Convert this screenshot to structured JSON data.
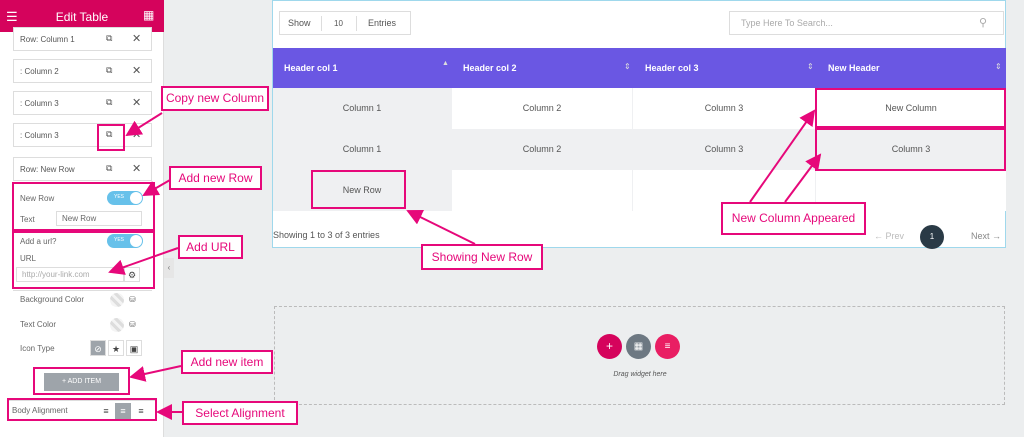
{
  "sidebar": {
    "title": "Edit Table",
    "rows": [
      {
        "label": "Row: Column 1"
      },
      {
        "label": ": Column 2"
      },
      {
        "label": ": Column 3"
      },
      {
        "label": ": Column 3"
      },
      {
        "label": "Row: New Row"
      }
    ],
    "new_row_label": "New Row",
    "text_label": "Text",
    "text_value": "New Row",
    "add_url_label": "Add a url?",
    "url_label": "URL",
    "url_placeholder": "http://your-link.com",
    "toggle_text": "YES",
    "bg_color_label": "Background Color",
    "text_color_label": "Text Color",
    "icon_type_label": "Icon Type",
    "add_item_label": "+ ADD ITEM",
    "body_alignment_label": "Body Alignment"
  },
  "table": {
    "show_label": "Show",
    "entries_count": "10",
    "entries_label": "Entries",
    "search_placeholder": "Type Here To Search...",
    "headers": [
      "Header col 1",
      "Header col 2",
      "Header col 3",
      "New Header"
    ],
    "rows": [
      [
        "Column 1",
        "Column 2",
        "Column 3",
        "New Column"
      ],
      [
        "Column 1",
        "Column 2",
        "Column 3",
        "Column 3"
      ],
      [
        "New Row",
        "",
        "",
        ""
      ]
    ],
    "info": "Showing 1 to 3 of 3 entries",
    "prev_label": "Prev",
    "current_page": "1",
    "next_label": "Next"
  },
  "drop_zone": {
    "text": "Drag widget here"
  },
  "annotations": {
    "copy_column": "Copy new Column",
    "add_row": "Add new Row",
    "add_url": "Add URL",
    "add_item": "Add new item",
    "select_alignment": "Select Alignment",
    "showing_new_row": "Showing New Row",
    "new_column_appeared": "New Column Appeared"
  },
  "colors": {
    "accent": "#d5035c",
    "annotation": "#e6087a",
    "table_header": "#6a57e3"
  }
}
